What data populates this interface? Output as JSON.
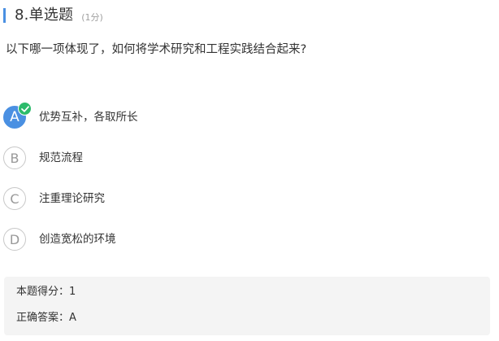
{
  "question": {
    "number_title": "8.单选题",
    "score_note": "(1分)",
    "stem": "以下哪一项体现了，如何将学术研究和工程实践结合起来?"
  },
  "options": [
    {
      "letter": "A",
      "text": "优势互补，各取所长",
      "selected": true
    },
    {
      "letter": "B",
      "text": "规范流程",
      "selected": false
    },
    {
      "letter": "C",
      "text": "注重理论研究",
      "selected": false
    },
    {
      "letter": "D",
      "text": "创造宽松的环境",
      "selected": false
    }
  ],
  "result": {
    "score_text": "本题得分：1",
    "correct_answer_text": "正确答案：A"
  },
  "colors": {
    "accent": "#4a90e2",
    "check": "#2cbb6b",
    "panel_bg": "#f4f4f4"
  },
  "icons": {
    "check_badge": "check-circle-icon"
  }
}
